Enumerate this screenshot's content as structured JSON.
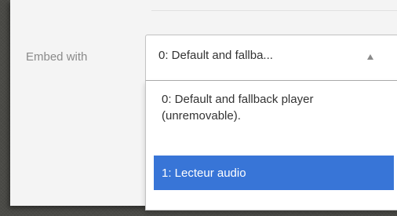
{
  "form": {
    "embed_label": "Embed with"
  },
  "select": {
    "value": "0: Default and fallba...",
    "arrow_icon": "triangle-up-icon",
    "options": [
      {
        "label": "0: Default and fallback player (unremovable).",
        "selected": false
      },
      {
        "label": "1: Lecteur audio",
        "selected": true
      }
    ]
  },
  "colors": {
    "highlight": "#3875d7",
    "label_text": "#8a8a8a",
    "panel_bg": "#f4f4f4",
    "backdrop": "#4b4b47"
  }
}
